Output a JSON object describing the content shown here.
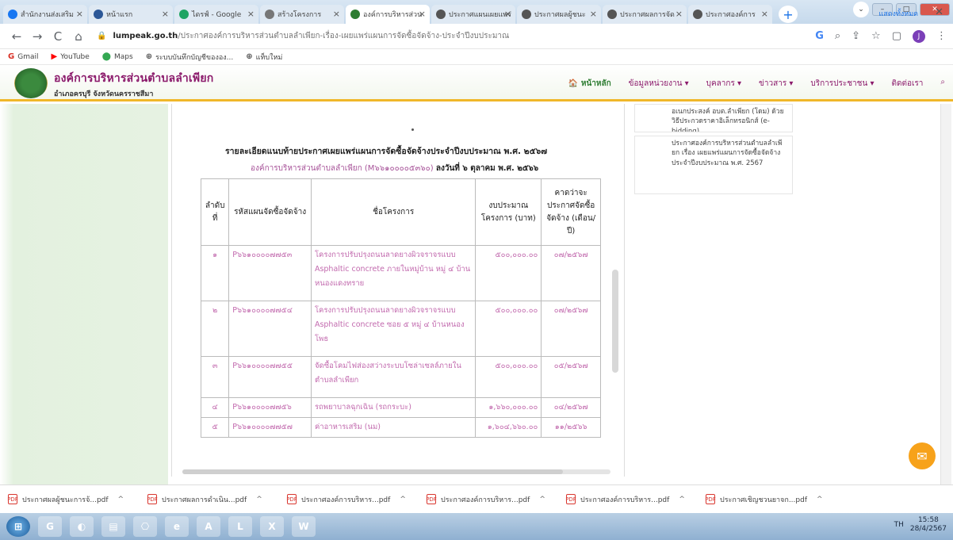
{
  "browser": {
    "tabs": [
      {
        "label": "สำนักงานส่งเสริม",
        "color": "#1877f2",
        "active": false
      },
      {
        "label": "หน้าแรก",
        "color": "#2b5797",
        "active": false
      },
      {
        "label": "ไดรฟ์ - Google",
        "color": "#1fa463",
        "active": false
      },
      {
        "label": "สร้างโครงการ",
        "color": "#777777",
        "active": false
      },
      {
        "label": "องค์การบริหารส่วน",
        "color": "#2e7d32",
        "active": true
      },
      {
        "label": "ประกาศแผนเผยแพร่",
        "color": "#555555",
        "active": false
      },
      {
        "label": "ประกาศผลผู้ชนะ",
        "color": "#555555",
        "active": false
      },
      {
        "label": "ประกาศผลการจัด",
        "color": "#555555",
        "active": false
      },
      {
        "label": "ประกาศองค์การ",
        "color": "#555555",
        "active": false
      }
    ],
    "tab_close": "×",
    "new_tab": "+",
    "window_controls": {
      "dropdown": "⌄",
      "minimize": "–",
      "maximize": "□",
      "close": "✕"
    },
    "nav": {
      "back": "←",
      "forward": "→",
      "reload": "C",
      "home": "⌂"
    },
    "url_domain": "lumpeak.go.th",
    "url_path": "/ประกาศองค์การบริหารส่วนตำบลลำเพียก-เรื่อง-เผยแพร่แผนการจัดซื้อจัดจ้าง-ประจำปีงบประมาณ",
    "lock": "🔒",
    "toolbar_icons": {
      "google": "G",
      "search": "⌕",
      "share": "⇪",
      "star": "☆",
      "sidebar": "▢",
      "profile": "J",
      "menu": "⋮"
    },
    "bookmarks": [
      {
        "label": "Gmail",
        "icon": "G",
        "color": "#d93025"
      },
      {
        "label": "YouTube",
        "icon": "▶",
        "color": "#ff0000"
      },
      {
        "label": "Maps",
        "icon": "⬤",
        "color": "#34a853"
      },
      {
        "label": "ระบบบันทึกบัญชีขององ...",
        "icon": "⊕",
        "color": "#555555"
      },
      {
        "label": "แท็บใหม่",
        "icon": "⊕",
        "color": "#555555"
      }
    ]
  },
  "site": {
    "title": "องค์การบริหารส่วนตำบลลำเพียก",
    "subtitle": "อำเภอครบุรี จังหวัดนครราชสีมา",
    "nav": [
      "🏠 หน้าหลัก",
      "ข้อมูลหน่วยงาน ▾",
      "บุคลากร ▾",
      "ข่าวสาร ▾",
      "บริการประชาชน ▾",
      "ติดต่อเรา",
      "⌕"
    ]
  },
  "document": {
    "title": "รายละเอียดแนบท้ายประกาศเผยแพร่แผนการจัดซื้อจัดจ้างประจำปีงบประมาณ พ.ศ. ๒๕๖๗",
    "org_line": "องค์การบริหารส่วนตำบลลำเพียก (M๖๖๑๐๐๐๐๕๓๖๐)",
    "date_line": "ลงวันที่ ๖ ตุลาคม พ.ศ. ๒๕๖๖",
    "table_headers": [
      "ลำดับที่",
      "รหัสแผนจัดซื้อจัดจ้าง",
      "ชื่อโครงการ",
      "งบประมาณโครงการ (บาท)",
      "คาดว่าจะประกาศจัดซื้อจัดจ้าง (เดือน/ปี)"
    ],
    "rows": [
      {
        "no": "๑",
        "code": "P๖๖๑๐๐๐๐๗๗๕๓",
        "name": "โครงการปรับปรุงถนนลาดยางผิวจราจรแบบ Asphaltic concrete ภายในหมู่บ้าน หมู่ ๔ บ้านหนองแดงทราย",
        "budget": "๕๐๐,๐๐๐.๐๐",
        "date": "๐๗/๒๕๖๗"
      },
      {
        "no": "๒",
        "code": "P๖๖๑๐๐๐๐๗๗๕๔",
        "name": "โครงการปรับปรุงถนนลาดยางผิวจราจรแบบ Asphaltic concrete ซอย ๕ หมู่ ๔ บ้านหนองโพธ",
        "budget": "๕๐๐,๐๐๐.๐๐",
        "date": "๐๗/๒๕๖๗"
      },
      {
        "no": "๓",
        "code": "P๖๖๑๐๐๐๐๗๗๕๕",
        "name": "จัดซื้อโคมไฟส่องสว่างระบบโซล่าเซลล์ภายในตำบลลำเพียก",
        "budget": "๕๐๐,๐๐๐.๐๐",
        "date": "๐๕/๒๕๖๗"
      },
      {
        "no": "๔",
        "code": "P๖๖๑๐๐๐๐๗๗๕๖",
        "name": "รถพยาบาลฉุกเฉิน (รถกระบะ)",
        "budget": "๑,๖๖๐,๐๐๐.๐๐",
        "date": "๐๔/๒๕๖๗"
      },
      {
        "no": "๕",
        "code": "P๖๖๑๐๐๐๐๗๗๕๗",
        "name": "ค่าอาหารเสริม (นม)",
        "budget": "๑,๖๐๔,๖๖๐.๐๐",
        "date": "๑๑/๒๕๖๖"
      }
    ]
  },
  "sidebar": {
    "card1": "อเนกประสงค์ อบต.ลำเพียก (โดม) ด้วยวิธีประกวดราคาอิเล็กทรอนิกส์ (e-bidding)",
    "card2": "ประกาศองค์การบริหารส่วนตำบลลำเพียก เรื่อง เผยแพร่แผนการจัดซื้อจัดจ้าง ประจำปีงบประมาณ พ.ศ. 2567"
  },
  "downloads": {
    "items": [
      "ประกาศผลผู้ชนะการจ้...pdf",
      "ประกาศผลการดำเนิน...pdf",
      "ประกาศองค์การบริหาร...pdf",
      "ประกาศองค์การบริหาร...pdf",
      "ประกาศองค์การบริหาร...pdf",
      "ประกาศเชิญชวนยาจก...pdf"
    ],
    "caret": "^",
    "pdf_badge": "PDF",
    "show_all": "แสดงทั้งหมด",
    "close": "✕"
  },
  "taskbar": {
    "apps": [
      "⊞",
      "G",
      "◐",
      "▤",
      "⎔",
      "e",
      "A",
      "L",
      "X",
      "W"
    ],
    "tray_lang": "TH",
    "time": "15:58",
    "date": "28/4/2567"
  },
  "messenger_icon": "✉"
}
